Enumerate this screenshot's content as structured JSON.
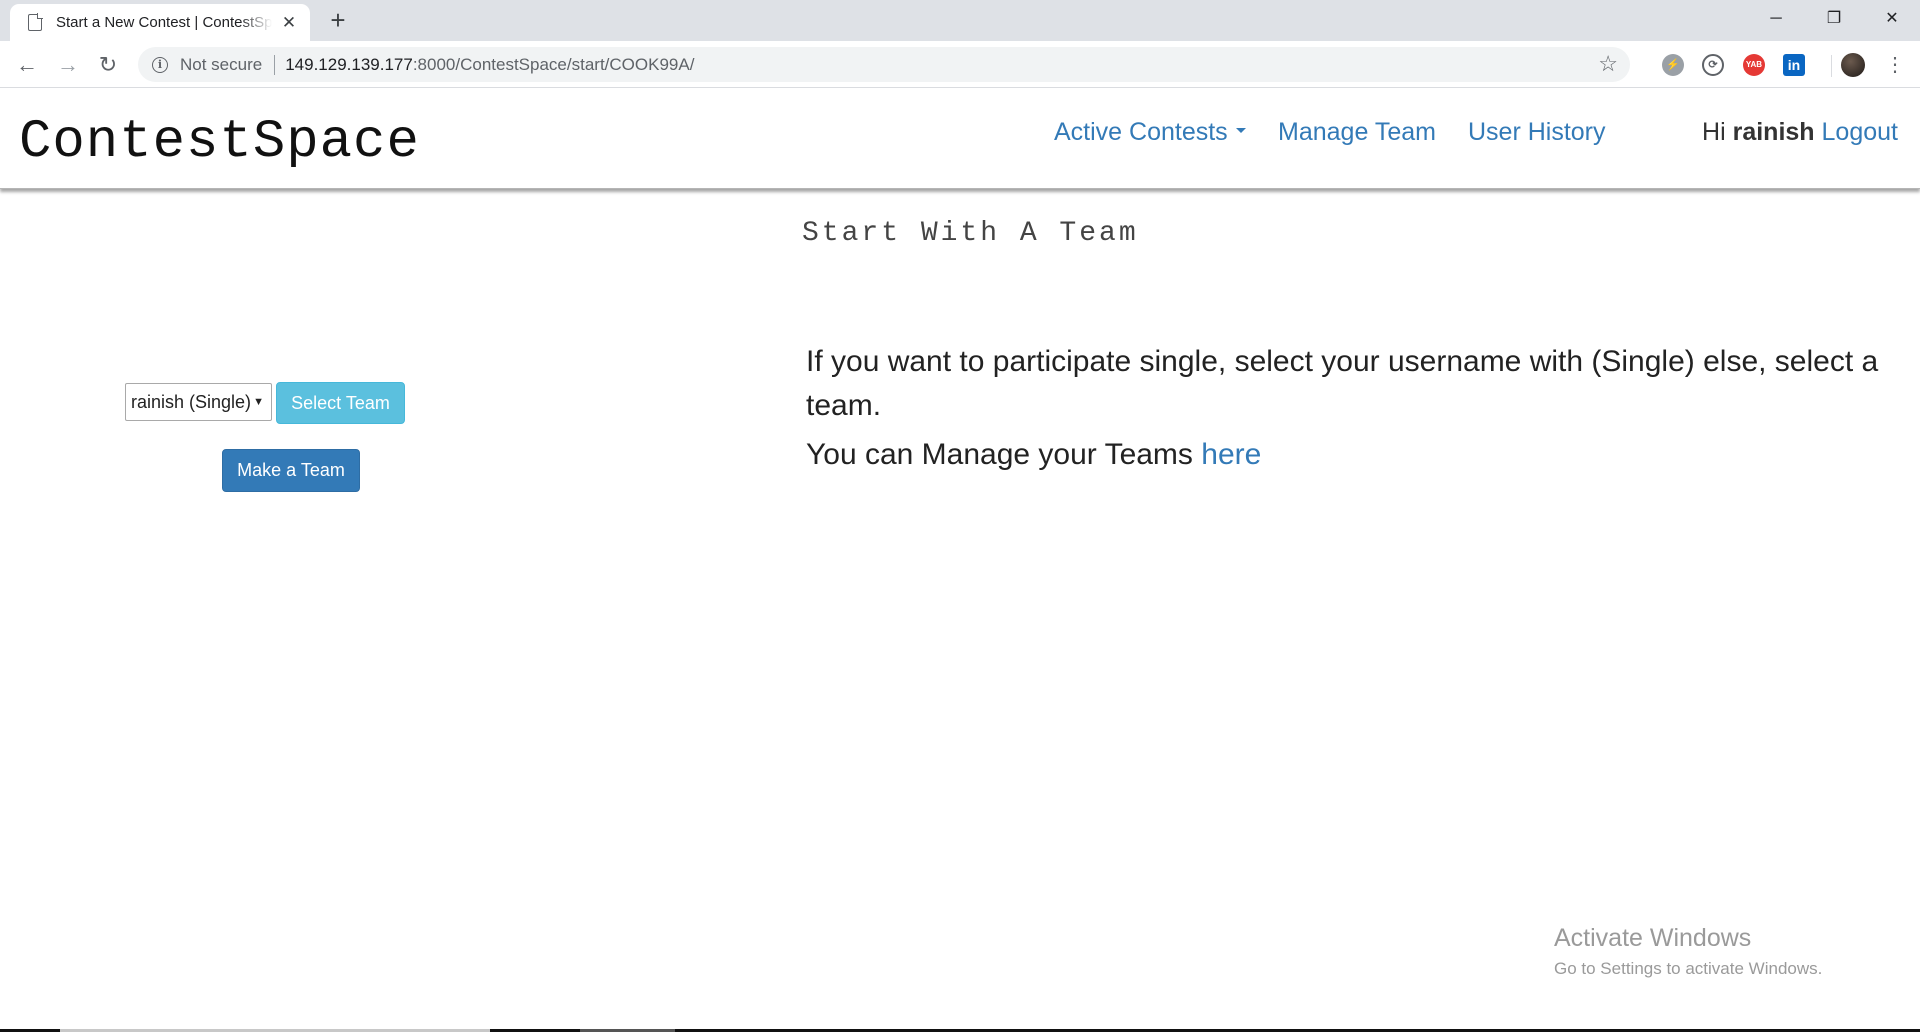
{
  "browser": {
    "tab_title": "Start a New Contest | ContestSpace",
    "tab_close": "✕",
    "new_tab": "+",
    "security_label": "Not secure",
    "url_host": "149.129.139.177",
    "url_path": ":8000/ContestSpace/start/COOK99A/",
    "window_controls": {
      "minimize": "─",
      "maximize": "❐",
      "close": "✕"
    },
    "nav": {
      "back": "←",
      "forward": "→",
      "reload": "↻"
    },
    "extensions": [
      "lightning-extension",
      "sync-extension",
      "yab-extension",
      "linkedin-extension",
      "profile-avatar"
    ],
    "ext_labels": {
      "yab": "YAB",
      "linkedin": "in"
    }
  },
  "header": {
    "brand": "ContestSpace",
    "nav": {
      "active_contests": "Active Contests",
      "manage_team": "Manage Team",
      "user_history": "User History"
    },
    "greeting_prefix": "Hi ",
    "username": "rainish",
    "logout": "Logout"
  },
  "main": {
    "heading": "Start With A Team",
    "team_select": {
      "selected": "rainish (Single)"
    },
    "select_team_button": "Select Team",
    "make_team_button": "Make a Team",
    "info_line1": "If you want to participate single, select your username with (Single) else, select a team.",
    "info_line2_prefix": "You can Manage your Teams ",
    "info_line2_link": "here"
  },
  "watermark": {
    "title": "Activate Windows",
    "subtitle": "Go to Settings to activate Windows."
  },
  "colors": {
    "link": "#337ab7",
    "btn_info": "#5bc0de",
    "btn_primary": "#337ab7"
  }
}
